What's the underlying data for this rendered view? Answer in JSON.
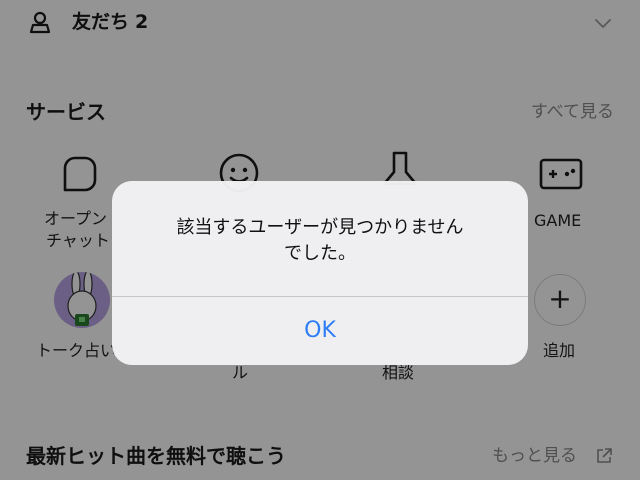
{
  "friends": {
    "label": "友だち",
    "count": "2"
  },
  "services": {
    "title": "サービス",
    "see_all": "すべて見る",
    "items": [
      {
        "label_line1": "オープン",
        "label_line2": "チャット"
      },
      {
        "label_line1": "",
        "label_line2": ""
      },
      {
        "label_line1": "",
        "label_line2": ""
      },
      {
        "label_line1": "GAME",
        "label_line2": ""
      }
    ],
    "row2": [
      {
        "label": "トーク占い"
      },
      {
        "label": "ル"
      },
      {
        "label": "相談"
      },
      {
        "label": "追加"
      }
    ],
    "add_symbol": "+"
  },
  "music": {
    "title": "最新ヒット曲を無料で聴こう",
    "more": "もっと見る"
  },
  "alert": {
    "message_line1": "該当するユーザーが見つかりません",
    "message_line2": "でした。",
    "ok_label": "OK"
  },
  "colors": {
    "accent": "#2f7ef6",
    "avatar_bg": "#b9a4e6",
    "muted_text": "#8a8a8a"
  },
  "icons": [
    "person-icon",
    "chevron-down-icon",
    "openchat-icon",
    "smiley-icon",
    "pin-icon",
    "gamepad-icon",
    "external-link-icon"
  ]
}
